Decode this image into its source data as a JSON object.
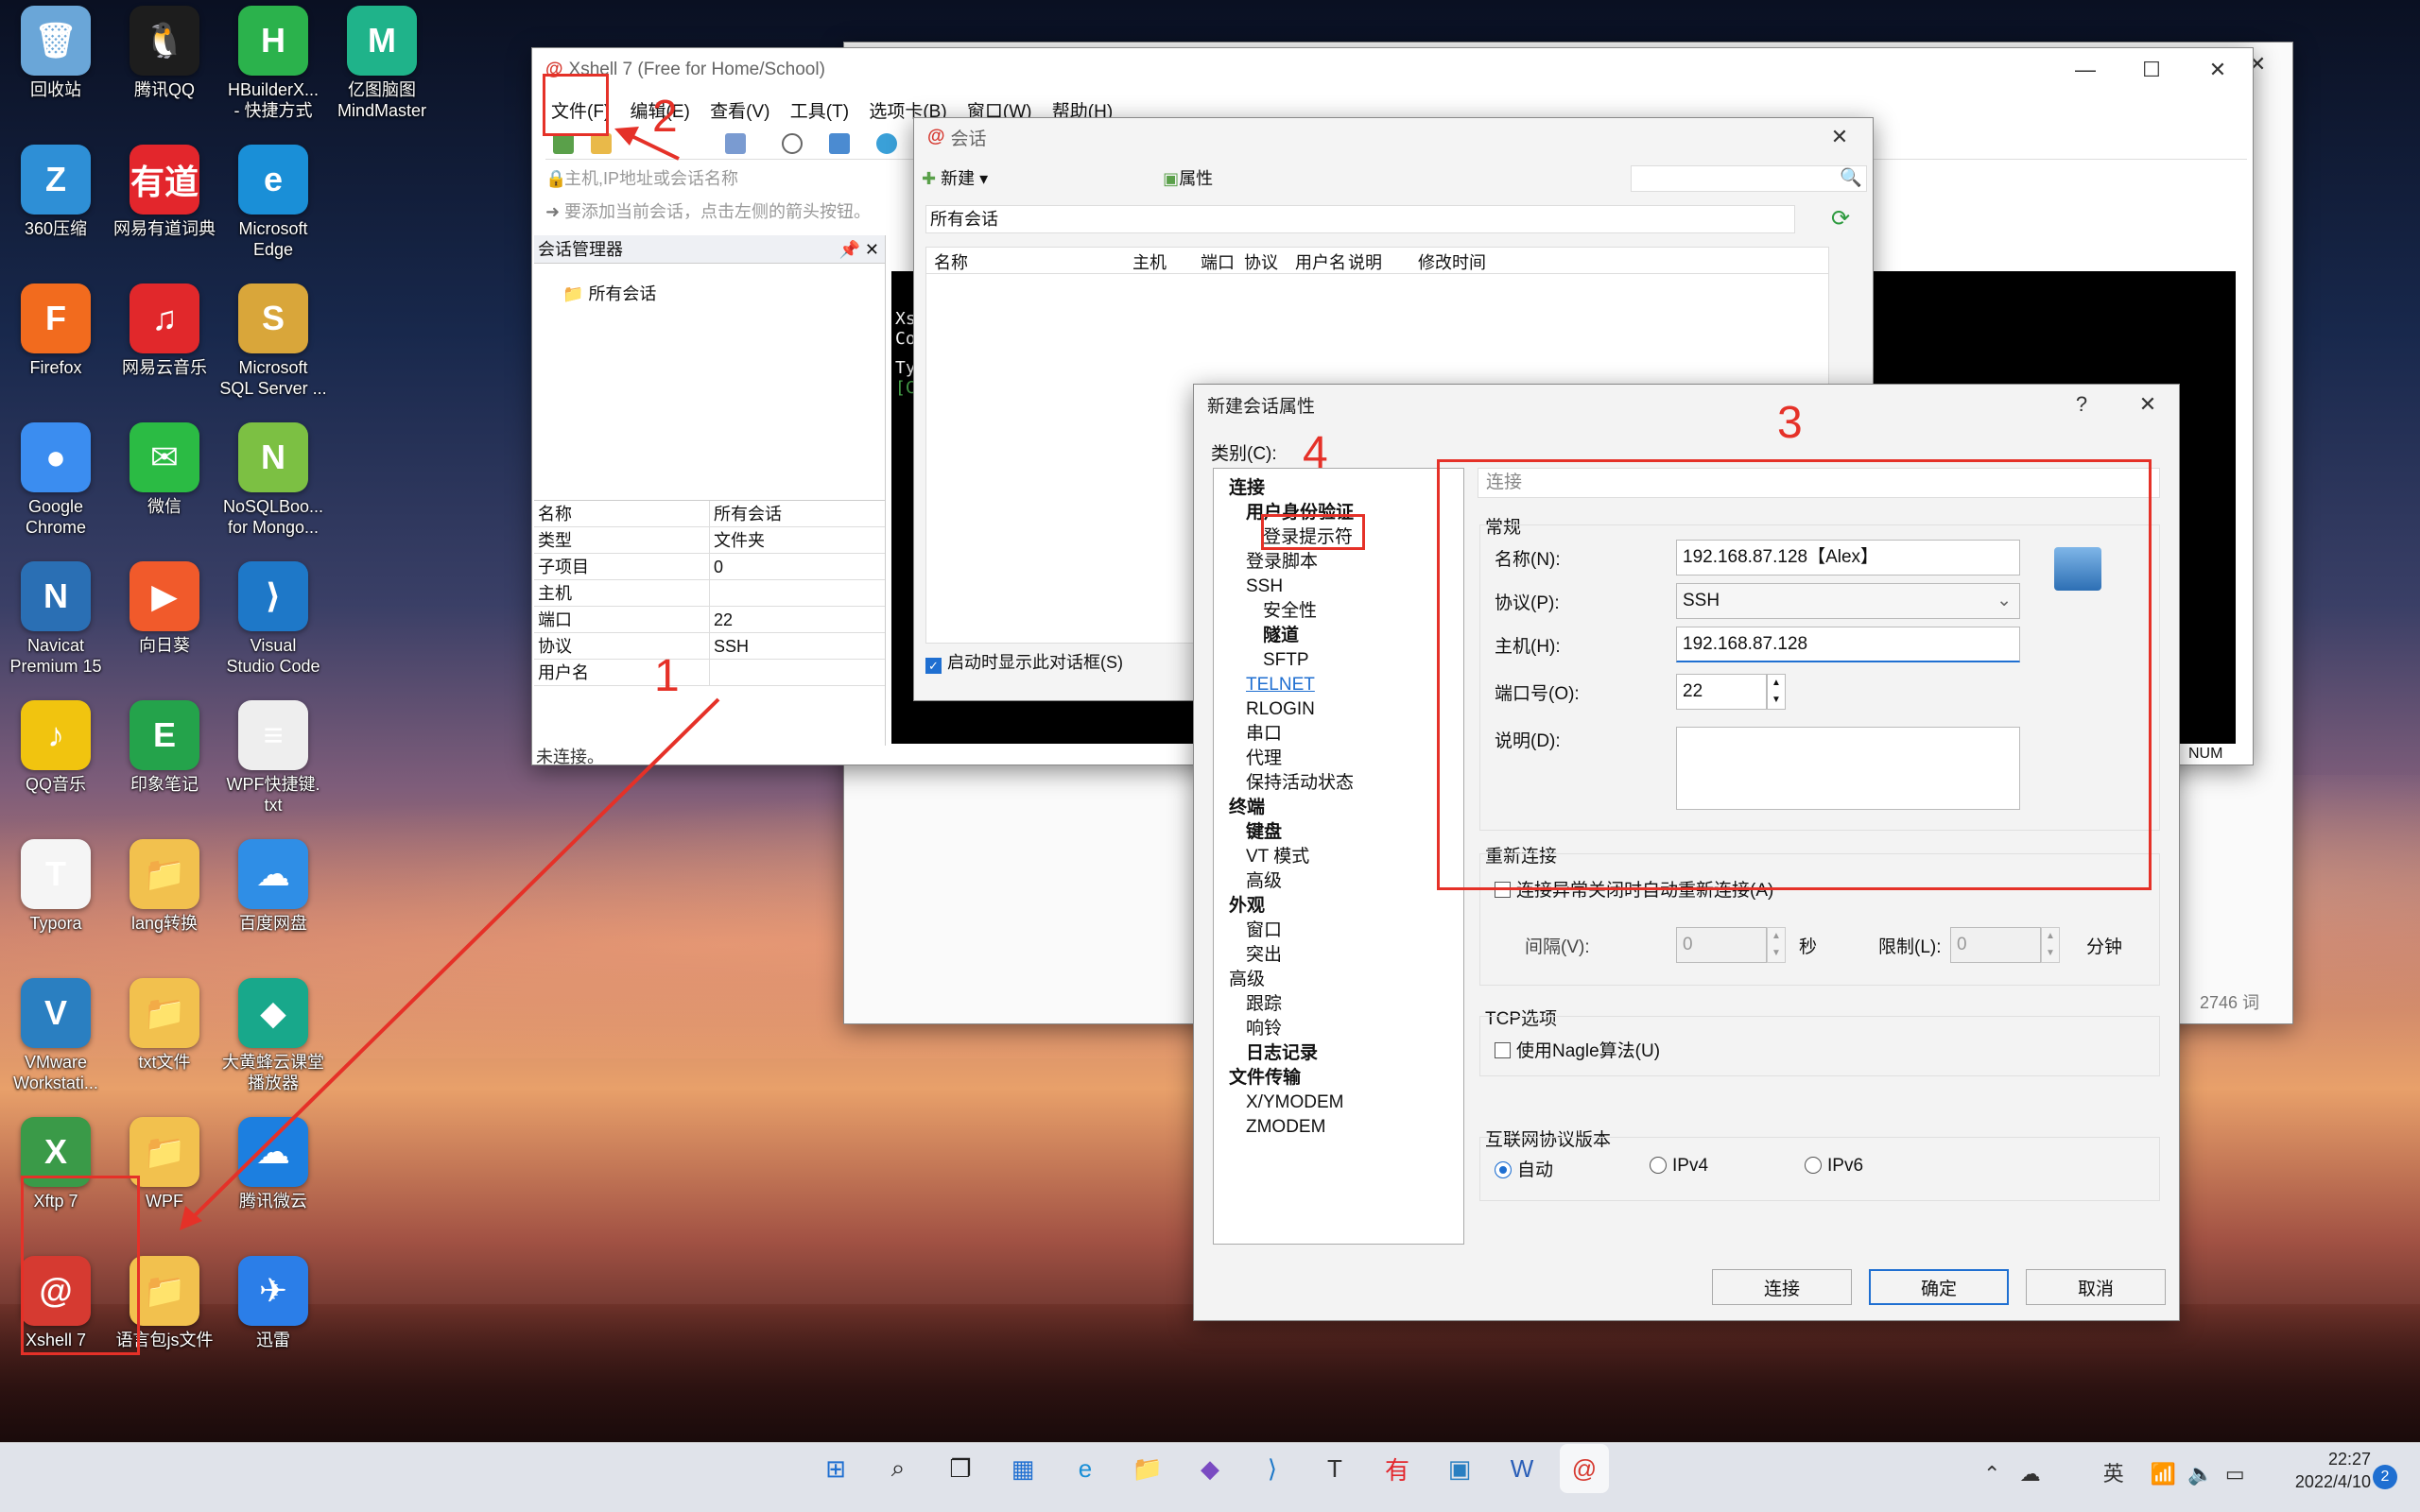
{
  "desktop_icons": [
    {
      "label": "回收站",
      "glyph": "🗑",
      "color": "#6aa6d8"
    },
    {
      "label": "腾讯QQ",
      "glyph": "🐧",
      "color": "#1d1d1d"
    },
    {
      "label": "HBuilderX...\n- 快捷方式",
      "glyph": "H",
      "color": "#2bb24c"
    },
    {
      "label": "亿图脑图\nMindMaster",
      "glyph": "M",
      "color": "#1fb38a"
    },
    {
      "label": "360压缩",
      "glyph": "Z",
      "color": "#2e8fd6"
    },
    {
      "label": "网易有道词典",
      "glyph": "有道",
      "color": "#e3262c"
    },
    {
      "label": "Microsoft\nEdge",
      "glyph": "e",
      "color": "#1a8fd7"
    },
    {
      "label": "Firefox",
      "glyph": "F",
      "color": "#f26b1e"
    },
    {
      "label": "网易云音乐",
      "glyph": "♫",
      "color": "#e1282b"
    },
    {
      "label": "Microsoft\nSQL Server ...",
      "glyph": "S",
      "color": "#d9a63a"
    },
    {
      "label": "Google\nChrome",
      "glyph": "●",
      "color": "#3b8df0"
    },
    {
      "label": "微信",
      "glyph": "✉",
      "color": "#2bbb44"
    },
    {
      "label": "NoSQLBoo...\nfor Mongo...",
      "glyph": "N",
      "color": "#7cc043"
    },
    {
      "label": "Navicat\nPremium 15",
      "glyph": "N",
      "color": "#2a6fb4"
    },
    {
      "label": "向日葵",
      "glyph": "▶",
      "color": "#f15a2b"
    },
    {
      "label": "Visual\nStudio Code",
      "glyph": "⟩",
      "color": "#1e78c8"
    },
    {
      "label": "QQ音乐",
      "glyph": "♪",
      "color": "#f1c40f"
    },
    {
      "label": "印象笔记",
      "glyph": "E",
      "color": "#24a34b"
    },
    {
      "label": "WPF快捷键.\ntxt",
      "glyph": "≡",
      "color": "#eeeeee"
    },
    {
      "label": "Typora",
      "glyph": "T",
      "color": "#f5f5f5"
    },
    {
      "label": "lang转换",
      "glyph": "📁",
      "color": "#f2c14e"
    },
    {
      "label": "百度网盘",
      "glyph": "☁",
      "color": "#2f8ee6"
    },
    {
      "label": "VMware\nWorkstati...",
      "glyph": "V",
      "color": "#2a7fc1"
    },
    {
      "label": "txt文件",
      "glyph": "📁",
      "color": "#f2c14e"
    },
    {
      "label": "大黄蜂云课堂\n播放器",
      "glyph": "◆",
      "color": "#18a88b"
    },
    {
      "label": "Xftp 7",
      "glyph": "X",
      "color": "#3a9a48"
    },
    {
      "label": "WPF",
      "glyph": "📁",
      "color": "#f2c14e"
    },
    {
      "label": "腾讯微云",
      "glyph": "☁",
      "color": "#1c7fe0"
    },
    {
      "label": "Xshell 7",
      "glyph": "@",
      "color": "#d63a31"
    },
    {
      "label": "语言包js文件",
      "glyph": "📁",
      "color": "#f2c14e"
    },
    {
      "label": "迅雷",
      "glyph": "✈",
      "color": "#2b7ee8"
    }
  ],
  "xshell": {
    "title": "Xshell 7 (Free for Home/School)",
    "menus": [
      "文件(F)",
      "编辑(E)",
      "查看(V)",
      "工具(T)",
      "选项卡(B)",
      "窗口(W)",
      "帮助(H)"
    ],
    "address_placeholder": "主机,IP地址或会话名称",
    "hint": "要添加当前会话，点击左侧的箭头按钮。",
    "session_manager": "会话管理器",
    "tree_root": "所有会话",
    "props": [
      [
        "名称",
        "所有会话"
      ],
      [
        "类型",
        "文件夹"
      ],
      [
        "子项目",
        "0"
      ],
      [
        "主机",
        ""
      ],
      [
        "端口",
        "22"
      ],
      [
        "协议",
        "SSH"
      ],
      [
        "用户名",
        ""
      ]
    ],
    "status": "未连接。",
    "num": "NUM",
    "terminal_lines": [
      "Xs",
      "Co",
      "Ty",
      "[C"
    ]
  },
  "back_window": {
    "word_count": "2746 词"
  },
  "session_dialog": {
    "title": "会话",
    "new": "新建",
    "properties": "属性",
    "breadcrumb": "所有会话",
    "columns": [
      "名称",
      "主机",
      "端口",
      "协议",
      "用户名",
      "说明",
      "修改时间"
    ],
    "startup_check": "启动时显示此对话框(S)"
  },
  "props_dialog": {
    "title": "新建会话属性",
    "help": "?",
    "category_label": "类别(C):",
    "tree": [
      {
        "t": "连接",
        "lvl": 0,
        "bold": true,
        "exp": "-"
      },
      {
        "t": "用户身份验证",
        "lvl": 1,
        "bold": true,
        "exp": "-"
      },
      {
        "t": "登录提示符",
        "lvl": 2,
        "bold": false
      },
      {
        "t": "登录脚本",
        "lvl": 1,
        "bold": false
      },
      {
        "t": "SSH",
        "lvl": 1,
        "bold": false,
        "exp": "-"
      },
      {
        "t": "安全性",
        "lvl": 2,
        "bold": false
      },
      {
        "t": "隧道",
        "lvl": 2,
        "bold": true
      },
      {
        "t": "SFTP",
        "lvl": 2,
        "bold": false
      },
      {
        "t": "TELNET",
        "lvl": 1,
        "bold": false,
        "link": true
      },
      {
        "t": "RLOGIN",
        "lvl": 1,
        "bold": false
      },
      {
        "t": "串口",
        "lvl": 1,
        "bold": false
      },
      {
        "t": "代理",
        "lvl": 1,
        "bold": false
      },
      {
        "t": "保持活动状态",
        "lvl": 1,
        "bold": false
      },
      {
        "t": "终端",
        "lvl": 0,
        "bold": true,
        "exp": "-"
      },
      {
        "t": "键盘",
        "lvl": 1,
        "bold": true
      },
      {
        "t": "VT 模式",
        "lvl": 1,
        "bold": false
      },
      {
        "t": "高级",
        "lvl": 1,
        "bold": false
      },
      {
        "t": "外观",
        "lvl": 0,
        "bold": true,
        "exp": "-"
      },
      {
        "t": "窗口",
        "lvl": 1,
        "bold": false
      },
      {
        "t": "突出",
        "lvl": 1,
        "bold": false
      },
      {
        "t": "高级",
        "lvl": 0,
        "bold": false,
        "exp": "-"
      },
      {
        "t": "跟踪",
        "lvl": 1,
        "bold": false
      },
      {
        "t": "响铃",
        "lvl": 1,
        "bold": false
      },
      {
        "t": "日志记录",
        "lvl": 1,
        "bold": true
      },
      {
        "t": "文件传输",
        "lvl": 0,
        "bold": true,
        "exp": "-"
      },
      {
        "t": "X/YMODEM",
        "lvl": 1,
        "bold": false
      },
      {
        "t": "ZMODEM",
        "lvl": 1,
        "bold": false
      }
    ],
    "section": "连接",
    "general": "常规",
    "name_label": "名称(N):",
    "name_value": "192.168.87.128【Alex】",
    "protocol_label": "协议(P):",
    "protocol_value": "SSH",
    "host_label": "主机(H):",
    "host_value": "192.168.87.128",
    "port_label": "端口号(O):",
    "port_value": "22",
    "desc_label": "说明(D):",
    "reconnect": "重新连接",
    "reconnect_check": "连接异常关闭时自动重新连接(A)",
    "interval_label": "间隔(V):",
    "interval_value": "0",
    "sec": "秒",
    "limit_label": "限制(L):",
    "limit_value": "0",
    "min": "分钟",
    "tcp": "TCP选项",
    "nagle": "使用Nagle算法(U)",
    "ipver": "互联网协议版本",
    "ip_auto": "自动",
    "ip_v4": "IPv4",
    "ip_v6": "IPv6",
    "btn_connect": "连接",
    "btn_ok": "确定",
    "btn_cancel": "取消"
  },
  "annotations": {
    "n1": "1",
    "n2": "2",
    "n3": "3",
    "n4": "4"
  },
  "taskbar": {
    "time": "22:27",
    "date": "2022/4/10",
    "ime": "英",
    "badge": "2",
    "apps": [
      "windows-start",
      "search",
      "task-view",
      "widgets",
      "edge",
      "explorer",
      "visual-studio",
      "vscode",
      "typora",
      "youdao",
      "vmware",
      "word",
      "xshell"
    ]
  }
}
